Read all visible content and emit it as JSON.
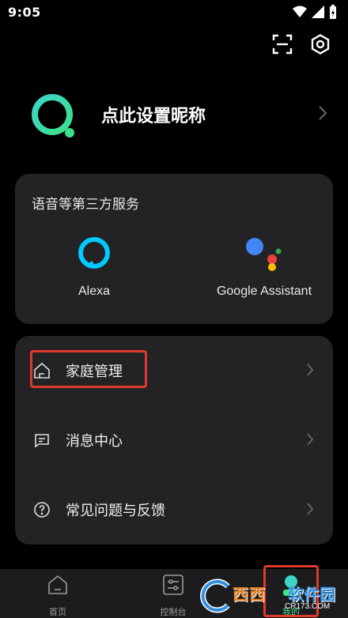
{
  "status_bar": {
    "time": "9:05",
    "icons": [
      "wifi-icon",
      "signal-icon",
      "battery-charging-icon"
    ]
  },
  "header": {
    "icons": [
      "scan-icon",
      "settings-icon"
    ]
  },
  "profile": {
    "nickname": "点此设置昵称",
    "accent_color": "#3ee08a"
  },
  "services": {
    "title": "语音等第三方服务",
    "items": [
      {
        "label": "Alexa",
        "icon": "alexa-icon",
        "color": "#00caff"
      },
      {
        "label": "Google Assistant",
        "icon": "google-assistant-icon"
      }
    ]
  },
  "menu": {
    "items": [
      {
        "label": "家庭管理",
        "icon": "home-icon"
      },
      {
        "label": "消息中心",
        "icon": "message-icon"
      },
      {
        "label": "常见问题与反馈",
        "icon": "help-icon"
      }
    ]
  },
  "tab_bar": {
    "tabs": [
      {
        "label": "首页",
        "icon": "home-tab-icon",
        "active": false
      },
      {
        "label": "控制台",
        "icon": "console-icon",
        "active": false
      },
      {
        "label": "我的",
        "icon": "profile-tab-icon",
        "active": true
      }
    ],
    "active_color": "#3ee08a"
  },
  "watermark": {
    "text1": "西西",
    "text2": "软件园",
    "url": "CR173.COM"
  },
  "colors": {
    "background": "#000000",
    "card": "#232325",
    "highlight": "#e0392c"
  }
}
